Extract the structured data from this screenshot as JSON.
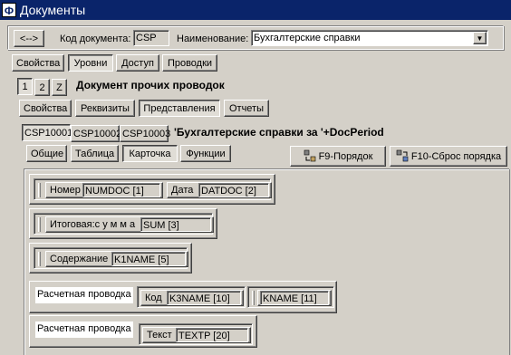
{
  "window": {
    "title": "Документы",
    "icon": "app-icon"
  },
  "toolbar": {
    "arrow_button": "<-->",
    "code_label": "Код документа:",
    "code_value": "CSP",
    "name_label": "Наименование:",
    "name_value": "Бухгалтерские справки"
  },
  "main_tabs": [
    "Свойства",
    "Уровни",
    "Доступ",
    "Проводки"
  ],
  "level_tabs": [
    "1",
    "2",
    "Z"
  ],
  "level_title": "Документ прочих проводок",
  "sub_tabs": [
    "Свойства",
    "Реквизиты",
    "Представления",
    "Отчеты"
  ],
  "view_tabs": [
    "CSP10001",
    "CSP10002",
    "CSP10003"
  ],
  "view_title": "'Бухгалтерские справки за '+DocPeriod",
  "card_tabs": [
    "Общие",
    "Таблица",
    "Карточка",
    "Функции"
  ],
  "actions": {
    "order": "F9-Порядок",
    "reset_order": "F10-Сброс порядка"
  },
  "rows": [
    {
      "fields": [
        {
          "caption": "Номер",
          "value": "NUMDOC [1]"
        },
        {
          "caption": "Дата",
          "value": "DATDOC [2]"
        }
      ]
    },
    {
      "fields": [
        {
          "caption": "Итоговая:с у м м а",
          "value": "SUM [3]"
        }
      ]
    },
    {
      "fields": [
        {
          "caption": "Содержание",
          "value": "K1NAME [5]"
        }
      ]
    },
    {
      "label": "Расчетная проводка",
      "fields": [
        {
          "caption": "Код",
          "value": "K3NAME [10]"
        },
        {
          "caption": "",
          "value": "KNAME [11]"
        }
      ]
    },
    {
      "label": "Расчетная проводка",
      "fields": [
        {
          "caption": "Текст",
          "value": "TEXTP [20]"
        }
      ]
    }
  ],
  "icons": {
    "order_icon": "sort-icon",
    "reset_icon": "reset-sort-icon",
    "dropdown": "chevron-down-icon"
  }
}
